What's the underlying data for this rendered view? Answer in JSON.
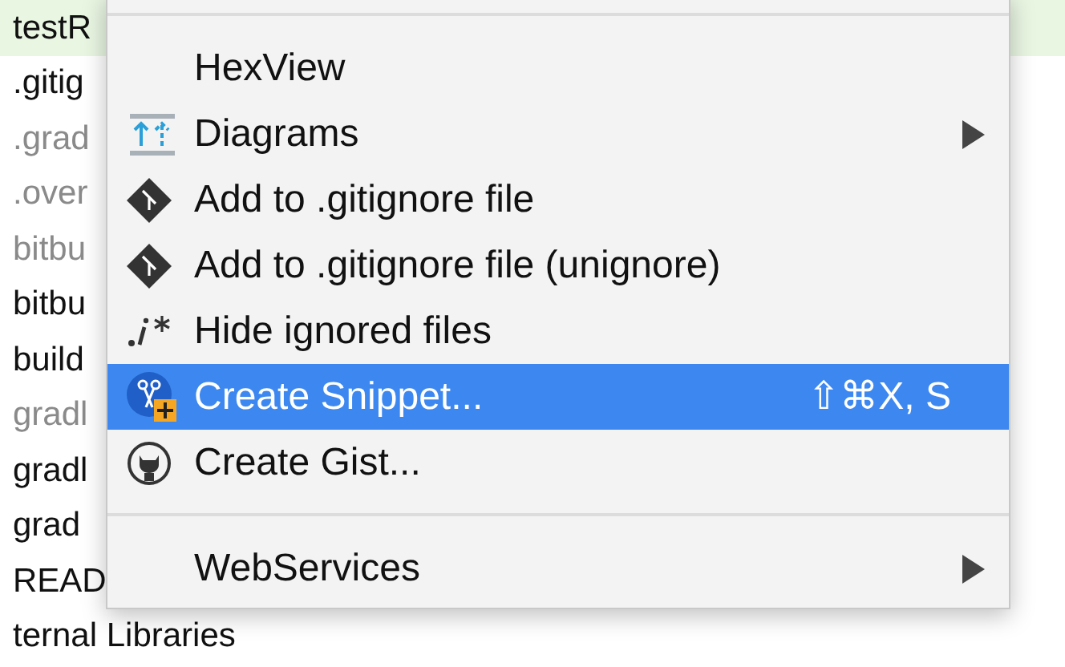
{
  "tree": {
    "items": [
      {
        "label": "testR",
        "muted": false,
        "selected": true
      },
      {
        "label": ".gitig",
        "muted": false,
        "selected": false
      },
      {
        "label": ".grad",
        "muted": true,
        "selected": false
      },
      {
        "label": ".over",
        "muted": true,
        "selected": false
      },
      {
        "label": "bitbu",
        "muted": true,
        "selected": false
      },
      {
        "label": "bitbu",
        "muted": false,
        "selected": false
      },
      {
        "label": "build",
        "muted": false,
        "selected": false
      },
      {
        "label": "gradl",
        "muted": true,
        "selected": false
      },
      {
        "label": "gradl",
        "muted": false,
        "selected": false
      },
      {
        "label": "grad",
        "muted": false,
        "selected": false
      },
      {
        "label": "READ",
        "muted": false,
        "selected": false
      },
      {
        "label": "ternal Libraries",
        "muted": false,
        "selected": false
      }
    ]
  },
  "menu": {
    "items": [
      {
        "kind": "separator"
      },
      {
        "kind": "plain",
        "label": "HexView",
        "selected": false
      },
      {
        "kind": "diagram",
        "label": "Diagrams",
        "submenu": true,
        "selected": false
      },
      {
        "kind": "git",
        "label": "Add to .gitignore file",
        "selected": false
      },
      {
        "kind": "git",
        "label": "Add to .gitignore file (unignore)",
        "selected": false
      },
      {
        "kind": "ignored",
        "label": "Hide ignored files",
        "selected": false
      },
      {
        "kind": "snippet",
        "label": "Create Snippet...",
        "shortcut": "⇧⌘X, S",
        "selected": true
      },
      {
        "kind": "github",
        "label": "Create Gist...",
        "selected": false
      },
      {
        "kind": "separator"
      },
      {
        "kind": "plain",
        "label": "WebServices",
        "submenu": true,
        "selected": false
      }
    ]
  }
}
